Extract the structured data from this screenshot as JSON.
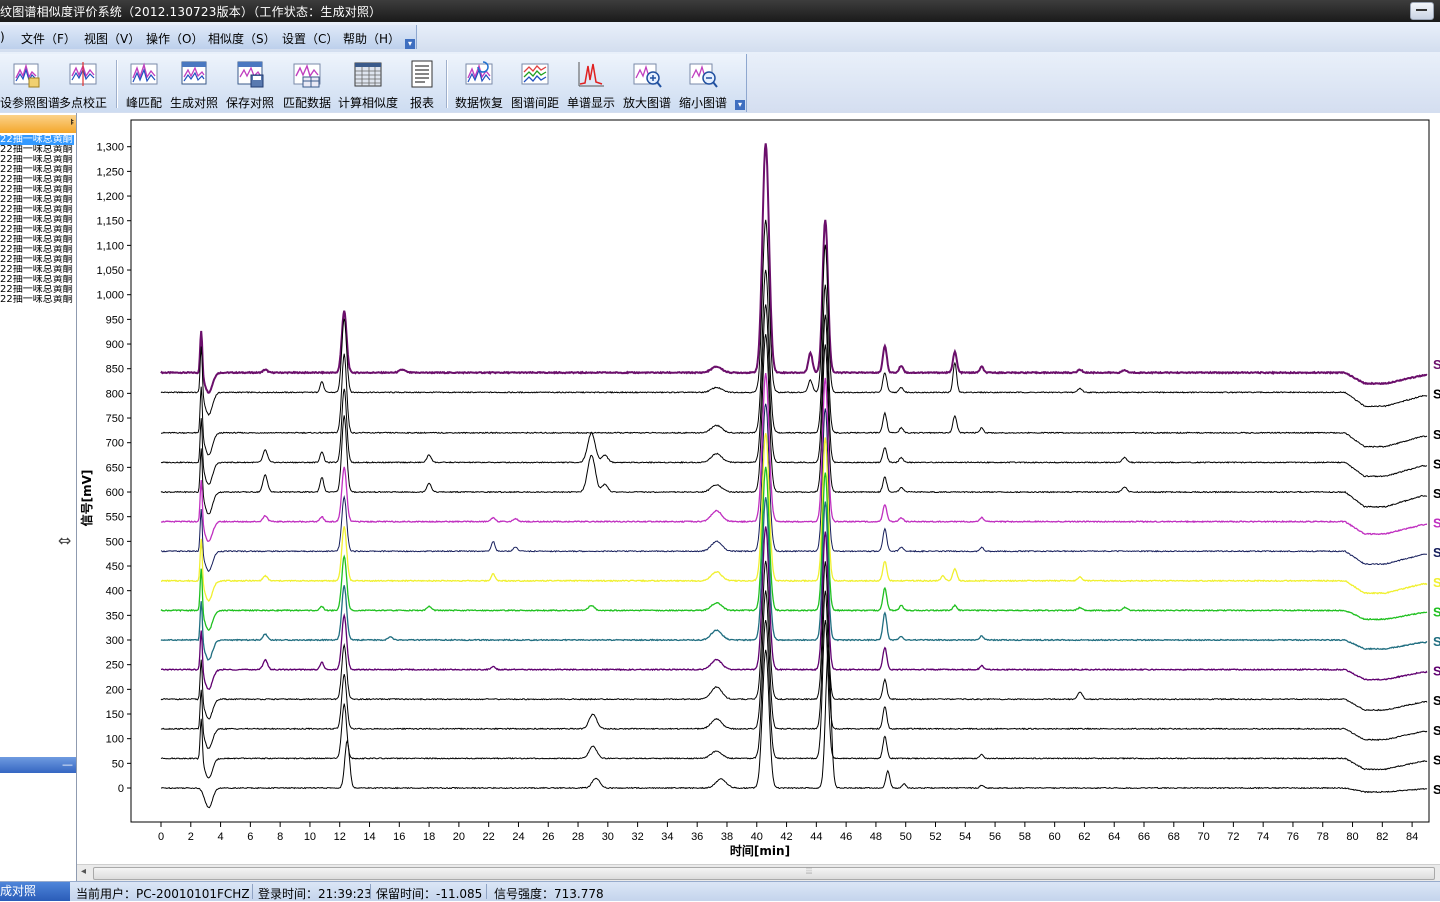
{
  "window": {
    "title": "纹图谱相似度评价系统（2012.130723版本）（工作状态：生成对照）"
  },
  "menu": {
    "items": [
      {
        "id": "partial",
        "label": ")"
      },
      {
        "id": "file",
        "label": "文件（F）"
      },
      {
        "id": "view",
        "label": "视图（V）"
      },
      {
        "id": "operate",
        "label": "操作（O）"
      },
      {
        "id": "similarity",
        "label": "相似度（S）"
      },
      {
        "id": "settings",
        "label": "设置（C）"
      },
      {
        "id": "help",
        "label": "帮助（H）"
      }
    ]
  },
  "toolbar": {
    "buttons": [
      {
        "id": "ref",
        "label": "设参照图谱",
        "icon": "reference-chart-icon"
      },
      {
        "id": "multipoint",
        "label": "多点校正",
        "icon": "multipoint-correct-icon"
      },
      {
        "id": "peakmatch",
        "label": "峰匹配",
        "icon": "peak-match-icon"
      },
      {
        "id": "gencontrol",
        "label": "生成对照",
        "icon": "generate-control-icon"
      },
      {
        "id": "savecontrol",
        "label": "保存对照",
        "icon": "save-control-icon"
      },
      {
        "id": "matchdata",
        "label": "匹配数据",
        "icon": "match-data-icon"
      },
      {
        "id": "calcsim",
        "label": "计算相似度",
        "icon": "calculate-similarity-icon"
      },
      {
        "id": "report",
        "label": "报表",
        "icon": "report-icon"
      },
      {
        "id": "restore",
        "label": "数据恢复",
        "icon": "data-restore-icon"
      },
      {
        "id": "spacing",
        "label": "图谱间距",
        "icon": "chart-spacing-icon"
      },
      {
        "id": "single",
        "label": "单谱显示",
        "icon": "single-spectrum-icon"
      },
      {
        "id": "zoomin",
        "label": "放大图谱",
        "icon": "zoom-in-icon"
      },
      {
        "id": "zoomout",
        "label": "缩小图谱",
        "icon": "zoom-out-icon"
      }
    ]
  },
  "sidebar": {
    "pin_glyph": "ᅣ",
    "collapse_glyph": "—",
    "samples": [
      {
        "label": "22抽一味总黄酮",
        "selected": true
      },
      {
        "label": "22抽一味总黄酮",
        "selected": false
      },
      {
        "label": "22抽一味总黄酮",
        "selected": false
      },
      {
        "label": "22抽一味总黄酮",
        "selected": false
      },
      {
        "label": "22抽一味总黄酮",
        "selected": false
      },
      {
        "label": "22抽一味总黄酮",
        "selected": false
      },
      {
        "label": "22抽一味总黄酮",
        "selected": false
      },
      {
        "label": "22抽一味总黄酮",
        "selected": false
      },
      {
        "label": "22抽一味总黄酮",
        "selected": false
      },
      {
        "label": "22抽一味总黄酮",
        "selected": false
      },
      {
        "label": "22抽一味总黄酮",
        "selected": false
      },
      {
        "label": "22抽一味总黄酮",
        "selected": false
      },
      {
        "label": "22抽一味总黄酮",
        "selected": false
      },
      {
        "label": "22抽一味总黄酮",
        "selected": false
      },
      {
        "label": "22抽一味总黄酮",
        "selected": false
      },
      {
        "label": "22抽一味总黄酮",
        "selected": false
      },
      {
        "label": "22抽一味总黄酮",
        "selected": false
      }
    ]
  },
  "statusbar": {
    "mode": "成对照",
    "user": "当前用户：PC-20010101FCHZ",
    "login_time": "登录时间：21:39:23",
    "retention_time": "保留时间：-11.085",
    "signal_strength": "信号强度：713.778"
  },
  "chart_data": {
    "type": "line",
    "xlabel": "时间[min]",
    "ylabel": "信号[mV]",
    "xlim": [
      0,
      85
    ],
    "ylim": [
      -20,
      1320
    ],
    "xticks": [
      0,
      2,
      4,
      6,
      8,
      10,
      12,
      14,
      16,
      18,
      20,
      22,
      24,
      26,
      28,
      30,
      32,
      34,
      36,
      38,
      40,
      42,
      44,
      46,
      48,
      50,
      52,
      54,
      56,
      58,
      60,
      62,
      64,
      66,
      68,
      70,
      72,
      74,
      76,
      78,
      80,
      82,
      84
    ],
    "yticks": [
      0,
      50,
      100,
      150,
      200,
      250,
      300,
      350,
      400,
      450,
      500,
      550,
      600,
      650,
      700,
      750,
      800,
      850,
      900,
      950,
      1000,
      1050,
      1100,
      1150,
      1200,
      1250,
      1300
    ],
    "x_start": 0,
    "x_end": 85,
    "series": [
      {
        "label": "S",
        "color": "#6b0f6b",
        "width": 2,
        "baseline": 842,
        "tail": -22,
        "peaks": [
          [
            2.7,
            90,
            0.07
          ],
          [
            3.2,
            -40,
            0.25
          ],
          [
            7.0,
            6,
            0.15
          ],
          [
            12.3,
            125,
            0.16
          ],
          [
            16.2,
            6,
            0.2
          ],
          [
            37.3,
            12,
            0.35
          ],
          [
            40.6,
            465,
            0.22
          ],
          [
            43.6,
            40,
            0.14
          ],
          [
            44.6,
            310,
            0.18
          ],
          [
            48.6,
            55,
            0.13
          ],
          [
            49.7,
            14,
            0.13
          ],
          [
            53.3,
            42,
            0.13
          ],
          [
            55.1,
            12,
            0.12
          ],
          [
            61.7,
            6,
            0.15
          ],
          [
            64.7,
            5,
            0.15
          ]
        ]
      },
      {
        "label": "S",
        "color": "#000000",
        "width": 1,
        "baseline": 802,
        "tail": -28,
        "peaks": [
          [
            2.7,
            100,
            0.07
          ],
          [
            3.2,
            -45,
            0.25
          ],
          [
            10.8,
            22,
            0.12
          ],
          [
            12.3,
            150,
            0.16
          ],
          [
            37.3,
            10,
            0.35
          ],
          [
            40.6,
            350,
            0.22
          ],
          [
            43.6,
            25,
            0.14
          ],
          [
            44.6,
            300,
            0.18
          ],
          [
            48.6,
            40,
            0.13
          ],
          [
            49.7,
            10,
            0.13
          ],
          [
            53.3,
            60,
            0.12
          ],
          [
            61.7,
            8,
            0.15
          ]
        ]
      },
      {
        "label": "S",
        "color": "#000000",
        "width": 1,
        "baseline": 720,
        "tail": -28,
        "peaks": [
          [
            2.7,
            100,
            0.07
          ],
          [
            3.2,
            -45,
            0.25
          ],
          [
            12.3,
            160,
            0.16
          ],
          [
            37.3,
            15,
            0.35
          ],
          [
            40.6,
            330,
            0.22
          ],
          [
            44.6,
            300,
            0.18
          ],
          [
            48.6,
            40,
            0.13
          ],
          [
            49.7,
            10,
            0.13
          ],
          [
            53.3,
            35,
            0.13
          ],
          [
            55.1,
            10,
            0.12
          ]
        ]
      },
      {
        "label": "S",
        "color": "#000000",
        "width": 1,
        "baseline": 660,
        "tail": -28,
        "peaks": [
          [
            2.7,
            95,
            0.07
          ],
          [
            3.2,
            -45,
            0.25
          ],
          [
            7.0,
            25,
            0.15
          ],
          [
            10.8,
            22,
            0.12
          ],
          [
            12.3,
            150,
            0.16
          ],
          [
            18.0,
            15,
            0.15
          ],
          [
            28.9,
            60,
            0.25
          ],
          [
            29.8,
            15,
            0.2
          ],
          [
            37.3,
            18,
            0.35
          ],
          [
            40.6,
            320,
            0.22
          ],
          [
            44.6,
            300,
            0.18
          ],
          [
            48.6,
            30,
            0.13
          ],
          [
            49.7,
            10,
            0.13
          ],
          [
            64.7,
            10,
            0.15
          ]
        ]
      },
      {
        "label": "S",
        "color": "#000000",
        "width": 1,
        "baseline": 600,
        "tail": -30,
        "peaks": [
          [
            2.7,
            95,
            0.07
          ],
          [
            3.2,
            -45,
            0.25
          ],
          [
            7.0,
            35,
            0.15
          ],
          [
            10.8,
            30,
            0.12
          ],
          [
            12.3,
            155,
            0.16
          ],
          [
            18.0,
            18,
            0.15
          ],
          [
            28.9,
            75,
            0.25
          ],
          [
            29.8,
            15,
            0.2
          ],
          [
            37.3,
            15,
            0.35
          ],
          [
            40.6,
            320,
            0.22
          ],
          [
            44.6,
            300,
            0.18
          ],
          [
            48.6,
            30,
            0.13
          ],
          [
            49.7,
            10,
            0.13
          ],
          [
            64.7,
            10,
            0.15
          ]
        ]
      },
      {
        "label": "S",
        "color": "#c030c0",
        "width": 1.3,
        "baseline": 540,
        "tail": -25,
        "peaks": [
          [
            2.7,
            90,
            0.07
          ],
          [
            3.2,
            -40,
            0.25
          ],
          [
            7.0,
            12,
            0.15
          ],
          [
            10.8,
            10,
            0.12
          ],
          [
            12.3,
            110,
            0.16
          ],
          [
            22.3,
            8,
            0.15
          ],
          [
            23.8,
            6,
            0.15
          ],
          [
            37.3,
            22,
            0.35
          ],
          [
            40.6,
            300,
            0.22
          ],
          [
            44.6,
            290,
            0.18
          ],
          [
            48.6,
            35,
            0.13
          ],
          [
            49.7,
            8,
            0.13
          ],
          [
            55.1,
            8,
            0.12
          ]
        ]
      },
      {
        "label": "S",
        "color": "#141c5a",
        "width": 1,
        "baseline": 480,
        "tail": -26,
        "peaks": [
          [
            2.7,
            90,
            0.07
          ],
          [
            3.2,
            -40,
            0.25
          ],
          [
            12.3,
            110,
            0.16
          ],
          [
            22.3,
            20,
            0.12
          ],
          [
            23.8,
            8,
            0.15
          ],
          [
            37.3,
            20,
            0.35
          ],
          [
            40.6,
            300,
            0.22
          ],
          [
            44.6,
            290,
            0.18
          ],
          [
            48.6,
            45,
            0.13
          ],
          [
            49.7,
            8,
            0.13
          ],
          [
            55.1,
            8,
            0.12
          ]
        ]
      },
      {
        "label": "S",
        "color": "#f0f030",
        "width": 1.3,
        "baseline": 420,
        "tail": -25,
        "peaks": [
          [
            2.7,
            90,
            0.07
          ],
          [
            3.2,
            -40,
            0.25
          ],
          [
            7.0,
            10,
            0.15
          ],
          [
            12.3,
            110,
            0.16
          ],
          [
            22.3,
            15,
            0.12
          ],
          [
            37.3,
            18,
            0.35
          ],
          [
            40.6,
            300,
            0.22
          ],
          [
            44.6,
            290,
            0.18
          ],
          [
            48.6,
            40,
            0.13
          ],
          [
            52.5,
            10,
            0.13
          ],
          [
            53.3,
            25,
            0.13
          ],
          [
            61.7,
            8,
            0.15
          ]
        ]
      },
      {
        "label": "S",
        "color": "#20c020",
        "width": 1.3,
        "baseline": 360,
        "tail": -18,
        "peaks": [
          [
            2.7,
            90,
            0.07
          ],
          [
            3.2,
            -40,
            0.25
          ],
          [
            10.8,
            8,
            0.12
          ],
          [
            12.3,
            110,
            0.16
          ],
          [
            18.0,
            8,
            0.15
          ],
          [
            28.9,
            10,
            0.2
          ],
          [
            37.3,
            15,
            0.35
          ],
          [
            40.6,
            290,
            0.22
          ],
          [
            44.6,
            280,
            0.18
          ],
          [
            48.6,
            45,
            0.13
          ],
          [
            49.7,
            10,
            0.13
          ],
          [
            53.3,
            10,
            0.13
          ],
          [
            61.7,
            6,
            0.15
          ],
          [
            64.7,
            6,
            0.15
          ]
        ]
      },
      {
        "label": "S",
        "color": "#206e80",
        "width": 1.3,
        "baseline": 300,
        "tail": -18,
        "peaks": [
          [
            2.7,
            85,
            0.07
          ],
          [
            3.2,
            -40,
            0.25
          ],
          [
            7.0,
            12,
            0.15
          ],
          [
            12.3,
            110,
            0.16
          ],
          [
            15.4,
            6,
            0.15
          ],
          [
            37.3,
            20,
            0.35
          ],
          [
            40.6,
            290,
            0.22
          ],
          [
            44.6,
            280,
            0.18
          ],
          [
            48.6,
            55,
            0.13
          ],
          [
            49.7,
            8,
            0.13
          ],
          [
            55.1,
            8,
            0.12
          ]
        ]
      },
      {
        "label": "S",
        "color": "#600070",
        "width": 1.3,
        "baseline": 240,
        "tail": -20,
        "peaks": [
          [
            2.7,
            85,
            0.07
          ],
          [
            3.2,
            -40,
            0.25
          ],
          [
            7.0,
            20,
            0.15
          ],
          [
            10.8,
            15,
            0.12
          ],
          [
            12.3,
            110,
            0.16
          ],
          [
            22.3,
            6,
            0.15
          ],
          [
            37.3,
            20,
            0.35
          ],
          [
            40.6,
            290,
            0.22
          ],
          [
            44.6,
            280,
            0.18
          ],
          [
            48.6,
            45,
            0.13
          ],
          [
            55.1,
            8,
            0.12
          ]
        ]
      },
      {
        "label": "S",
        "color": "#000000",
        "width": 1,
        "baseline": 180,
        "tail": -22,
        "peaks": [
          [
            2.7,
            85,
            0.07
          ],
          [
            3.2,
            -40,
            0.25
          ],
          [
            12.3,
            110,
            0.16
          ],
          [
            37.3,
            25,
            0.35
          ],
          [
            40.6,
            280,
            0.22
          ],
          [
            44.6,
            280,
            0.18
          ],
          [
            48.6,
            40,
            0.13
          ],
          [
            61.7,
            15,
            0.15
          ]
        ]
      },
      {
        "label": "S",
        "color": "#000000",
        "width": 1,
        "baseline": 120,
        "tail": -22,
        "peaks": [
          [
            2.7,
            85,
            0.07
          ],
          [
            3.2,
            -40,
            0.25
          ],
          [
            12.3,
            110,
            0.16
          ],
          [
            29.0,
            30,
            0.25
          ],
          [
            37.3,
            20,
            0.35
          ],
          [
            40.6,
            280,
            0.22
          ],
          [
            44.6,
            280,
            0.18
          ],
          [
            48.6,
            45,
            0.13
          ]
        ]
      },
      {
        "label": "S",
        "color": "#000000",
        "width": 1,
        "baseline": 60,
        "tail": -22,
        "peaks": [
          [
            2.7,
            85,
            0.07
          ],
          [
            3.2,
            -40,
            0.25
          ],
          [
            12.3,
            110,
            0.16
          ],
          [
            29.0,
            25,
            0.25
          ],
          [
            37.3,
            15,
            0.35
          ],
          [
            40.6,
            280,
            0.22
          ],
          [
            44.6,
            280,
            0.18
          ],
          [
            48.6,
            45,
            0.13
          ],
          [
            55.1,
            8,
            0.12
          ]
        ]
      },
      {
        "label": "S",
        "color": "#000000",
        "width": 1,
        "baseline": 0,
        "tail": -8,
        "peaks": [
          [
            2.7,
            0,
            0.07
          ],
          [
            3.2,
            -40,
            0.25
          ],
          [
            12.5,
            95,
            0.16
          ],
          [
            29.2,
            20,
            0.25
          ],
          [
            37.6,
            18,
            0.35
          ],
          [
            40.6,
            280,
            0.22
          ],
          [
            44.8,
            280,
            0.18
          ],
          [
            48.8,
            35,
            0.13
          ],
          [
            49.9,
            8,
            0.13
          ],
          [
            55.1,
            6,
            0.12
          ]
        ]
      }
    ]
  }
}
